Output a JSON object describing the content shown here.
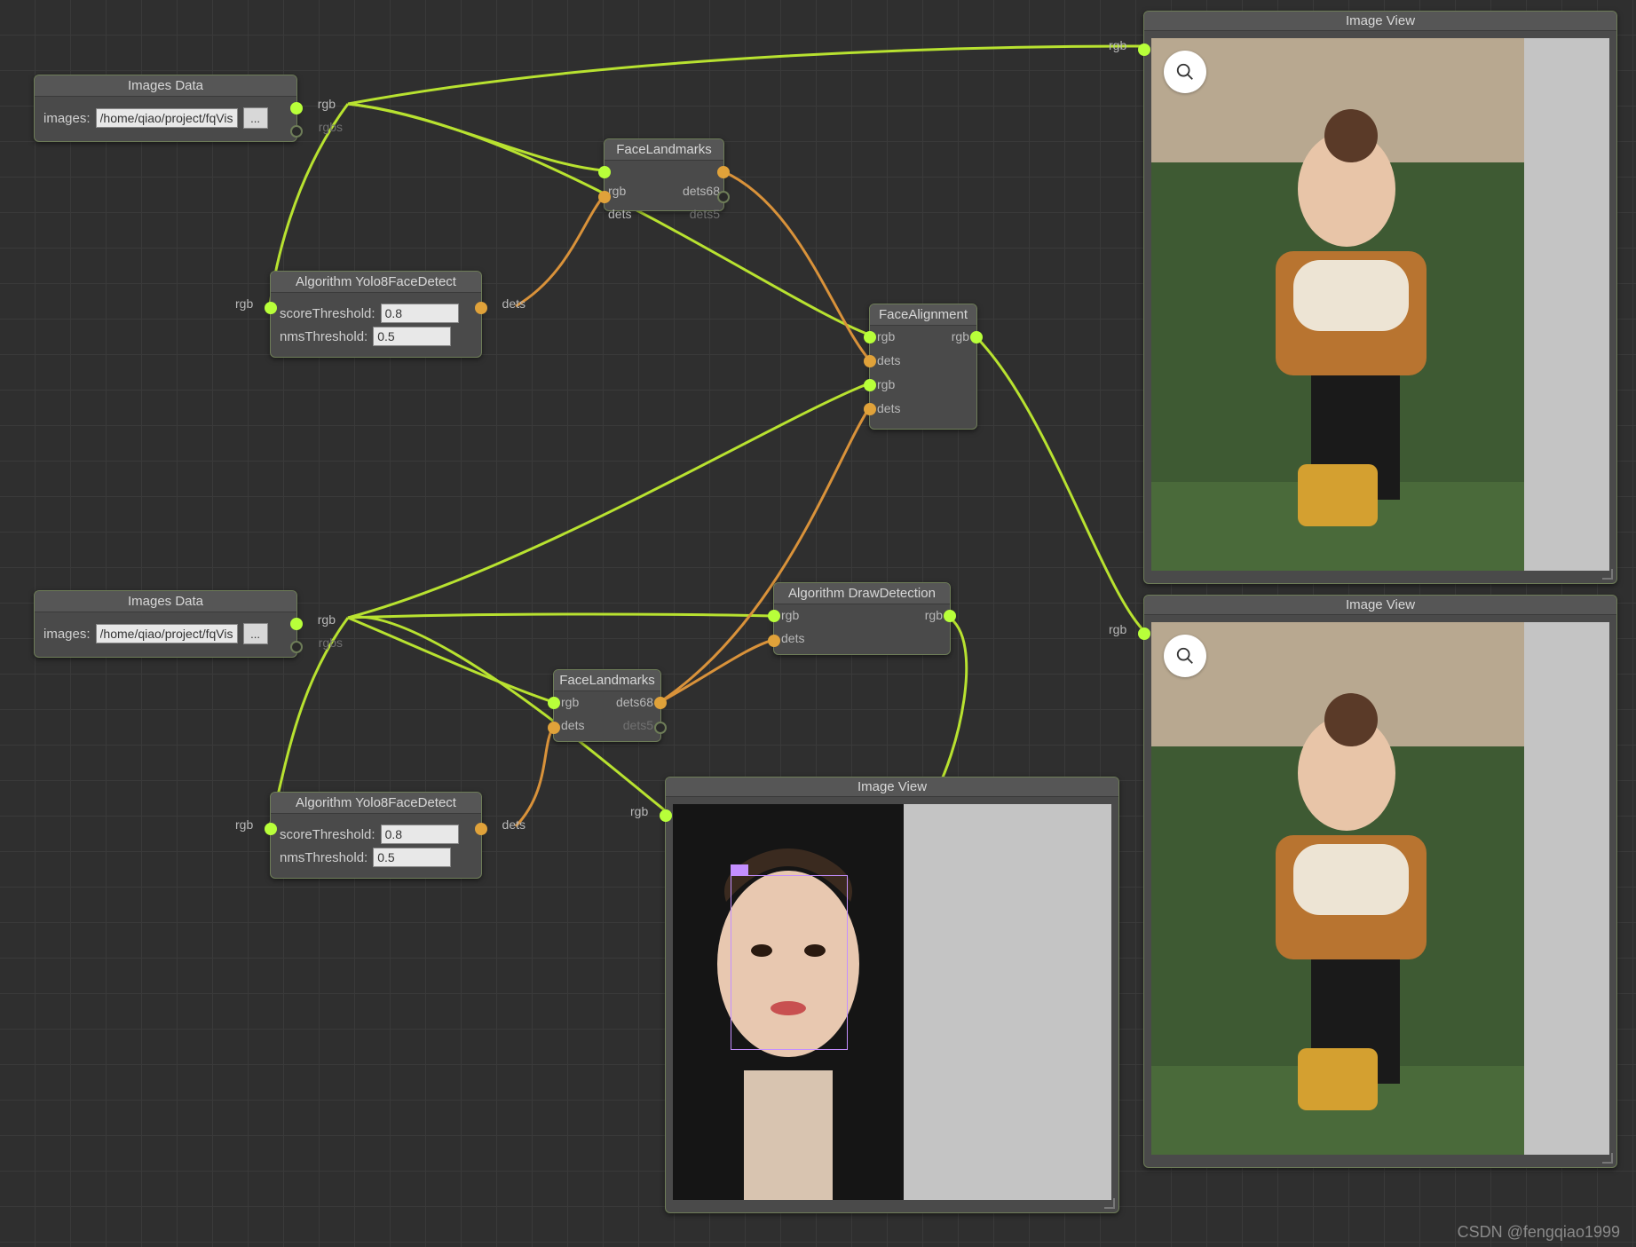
{
  "watermark": "CSDN @fengqiao1999",
  "nodes": {
    "images1": {
      "title": "Images Data",
      "field_label": "images:",
      "path": "/home/qiao/project/fqVision",
      "browse": "...",
      "out_rgb": "rgb",
      "out_rgbs": "rgbs"
    },
    "images2": {
      "title": "Images Data",
      "field_label": "images:",
      "path": "/home/qiao/project/fqVision",
      "browse": "...",
      "out_rgb": "rgb",
      "out_rgbs": "rgbs"
    },
    "yolo1": {
      "title": "Algorithm Yolo8FaceDetect",
      "score_label": "scoreThreshold:",
      "score_val": "0.8",
      "nms_label": "nmsThreshold:",
      "nms_val": "0.5",
      "in_rgb": "rgb",
      "out_dets": "dets"
    },
    "yolo2": {
      "title": "Algorithm Yolo8FaceDetect",
      "score_label": "scoreThreshold:",
      "score_val": "0.8",
      "nms_label": "nmsThreshold:",
      "nms_val": "0.5",
      "in_rgb": "rgb",
      "out_dets": "dets"
    },
    "landmarks1": {
      "title": "FaceLandmarks",
      "in_rgb": "rgb",
      "in_dets": "dets",
      "out_dets68": "dets68",
      "out_dets5": "dets5"
    },
    "landmarks2": {
      "title": "FaceLandmarks",
      "in_rgb": "rgb",
      "in_dets": "dets",
      "out_dets68": "dets68",
      "out_dets5": "dets5"
    },
    "alignment": {
      "title": "FaceAlignment",
      "in_rgb1": "rgb",
      "in_dets1": "dets",
      "in_rgb2": "rgb",
      "in_dets2": "dets",
      "out_rgb": "rgb"
    },
    "drawdet": {
      "title": "Algorithm DrawDetection",
      "in_rgb": "rgb",
      "in_dets": "dets",
      "out_rgb": "rgb"
    },
    "view1": {
      "title": "Image View",
      "in_rgb": "rgb"
    },
    "view2": {
      "title": "Image View",
      "in_rgb": "rgb"
    },
    "view3": {
      "title": "Image View",
      "in_rgb": "rgb"
    }
  }
}
